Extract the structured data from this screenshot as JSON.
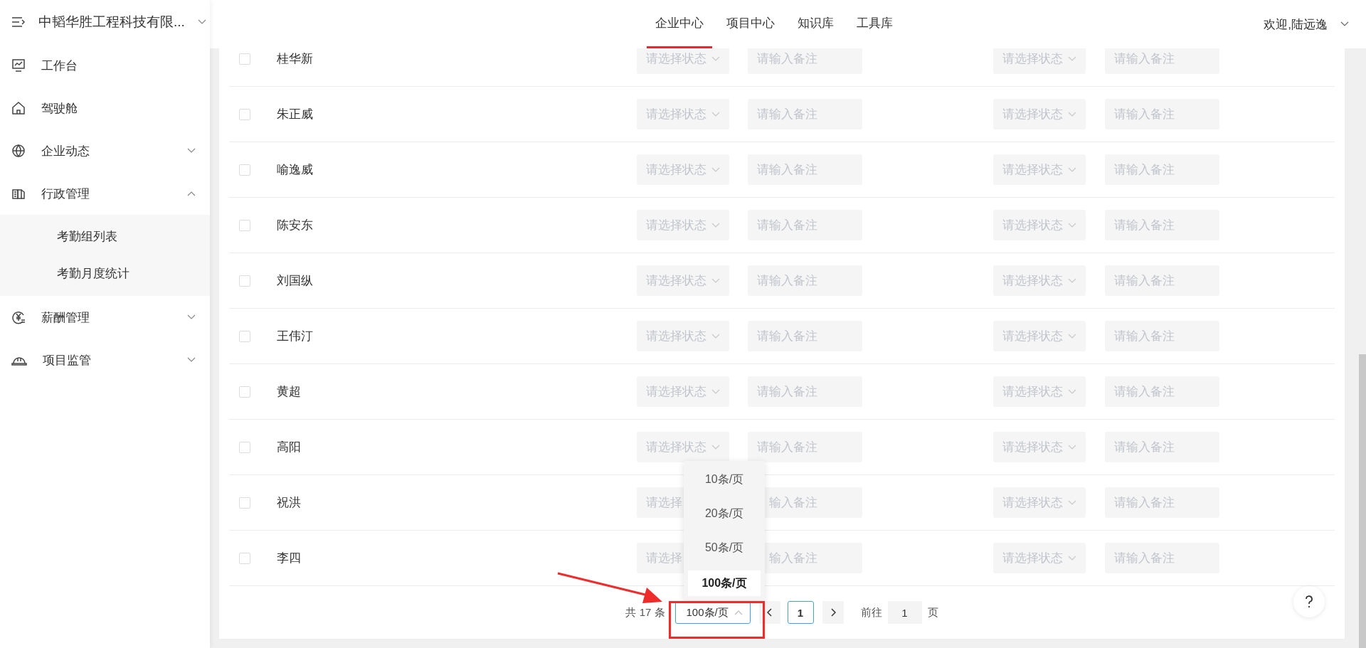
{
  "sidebar": {
    "company": "中韬华胜工程科技有限...",
    "items": [
      {
        "label": "工作台"
      },
      {
        "label": "驾驶舱"
      },
      {
        "label": "企业动态",
        "expanded": false
      },
      {
        "label": "行政管理",
        "expanded": true,
        "children": [
          {
            "label": "考勤组列表"
          },
          {
            "label": "考勤月度统计"
          }
        ]
      },
      {
        "label": "薪酬管理",
        "expanded": false
      },
      {
        "label": "项目监管",
        "expanded": false
      }
    ]
  },
  "header": {
    "tabs": [
      {
        "label": "企业中心",
        "selected": true
      },
      {
        "label": "项目中心",
        "selected": false
      },
      {
        "label": "知识库",
        "selected": false
      },
      {
        "label": "工具库",
        "selected": false
      }
    ],
    "user": "欢迎,陆远逸"
  },
  "table": {
    "rows": [
      {
        "name": "桂华新",
        "checked": false,
        "fields": [
          {
            "kind": "select",
            "placeholder": "请选择状态"
          },
          {
            "kind": "input",
            "placeholder": "请输入备注"
          },
          {
            "kind": "select",
            "placeholder": "请选择状态"
          },
          {
            "kind": "input",
            "placeholder": "请输入备注"
          }
        ]
      },
      {
        "name": "朱正威",
        "checked": false,
        "fields": [
          {
            "kind": "select",
            "placeholder": "请选择状态"
          },
          {
            "kind": "input",
            "placeholder": "请输入备注"
          },
          {
            "kind": "select",
            "placeholder": "请选择状态"
          },
          {
            "kind": "input",
            "placeholder": "请输入备注"
          }
        ]
      },
      {
        "name": "喻逸威",
        "checked": false,
        "fields": [
          {
            "kind": "select",
            "placeholder": "请选择状态"
          },
          {
            "kind": "input",
            "placeholder": "请输入备注"
          },
          {
            "kind": "select",
            "placeholder": "请选择状态"
          },
          {
            "kind": "input",
            "placeholder": "请输入备注"
          }
        ]
      },
      {
        "name": "陈安东",
        "checked": false,
        "fields": [
          {
            "kind": "select",
            "placeholder": "请选择状态"
          },
          {
            "kind": "input",
            "placeholder": "请输入备注"
          },
          {
            "kind": "select",
            "placeholder": "请选择状态"
          },
          {
            "kind": "input",
            "placeholder": "请输入备注"
          }
        ]
      },
      {
        "name": "刘国纵",
        "checked": false,
        "fields": [
          {
            "kind": "select",
            "placeholder": "请选择状态"
          },
          {
            "kind": "input",
            "placeholder": "请输入备注"
          },
          {
            "kind": "select",
            "placeholder": "请选择状态"
          },
          {
            "kind": "input",
            "placeholder": "请输入备注"
          }
        ]
      },
      {
        "name": "王伟汀",
        "checked": false,
        "fields": [
          {
            "kind": "select",
            "placeholder": "请选择状态"
          },
          {
            "kind": "input",
            "placeholder": "请输入备注"
          },
          {
            "kind": "select",
            "placeholder": "请选择状态"
          },
          {
            "kind": "input",
            "placeholder": "请输入备注"
          }
        ]
      },
      {
        "name": "黄超",
        "checked": false,
        "fields": [
          {
            "kind": "select",
            "placeholder": "请选择状态"
          },
          {
            "kind": "input",
            "placeholder": "请输入备注"
          },
          {
            "kind": "select",
            "placeholder": "请选择状态"
          },
          {
            "kind": "input",
            "placeholder": "请输入备注"
          }
        ]
      },
      {
        "name": "高阳",
        "checked": false,
        "fields": [
          {
            "kind": "select",
            "placeholder": "请选择状态"
          },
          {
            "kind": "input",
            "placeholder": "请输入备注"
          },
          {
            "kind": "select",
            "placeholder": "请选择状态"
          },
          {
            "kind": "input",
            "placeholder": "请输入备注"
          }
        ]
      },
      {
        "name": "祝洪",
        "checked": false,
        "fields": [
          {
            "kind": "select",
            "placeholder": "请选择",
            "caret": false
          },
          {
            "kind": "input",
            "placeholder": "输入备注"
          },
          {
            "kind": "select",
            "placeholder": "请选择状态"
          },
          {
            "kind": "input",
            "placeholder": "请输入备注"
          }
        ]
      },
      {
        "name": "李四",
        "checked": false,
        "fields": [
          {
            "kind": "select",
            "placeholder": "请选择",
            "caret": false
          },
          {
            "kind": "input",
            "placeholder": "输入备注"
          },
          {
            "kind": "select",
            "placeholder": "请选择状态"
          },
          {
            "kind": "input",
            "placeholder": "请输入备注"
          }
        ]
      }
    ]
  },
  "pagination": {
    "total": "共 17 条",
    "page_size": "100条/页",
    "page_size_open": true,
    "page_size_options": [
      {
        "label": "10条/页",
        "selected": false
      },
      {
        "label": "20条/页",
        "selected": false
      },
      {
        "label": "50条/页",
        "selected": false
      },
      {
        "label": "100条/页",
        "selected": true
      }
    ],
    "page": "1",
    "jump_label": "前往",
    "jump_value": "1",
    "page_unit": "页"
  }
}
